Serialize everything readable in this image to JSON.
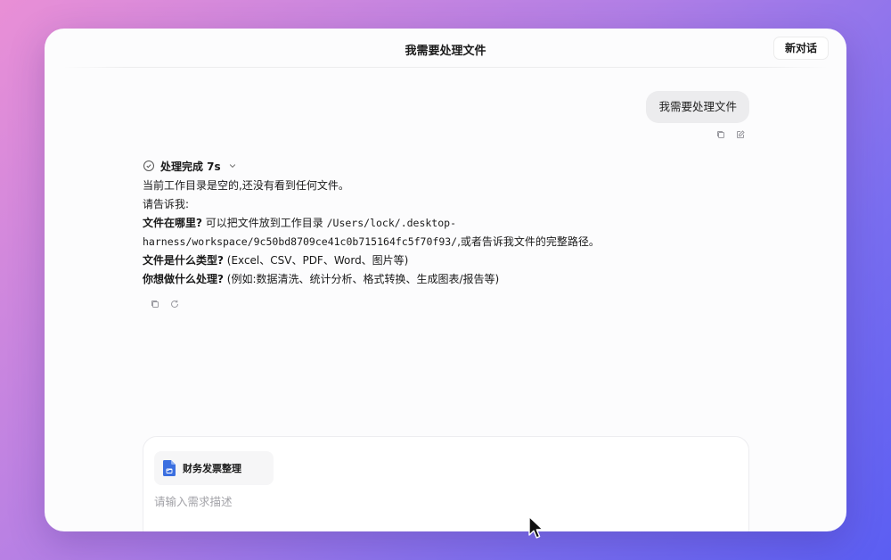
{
  "header": {
    "title": "我需要处理文件",
    "new_chat_label": "新对话"
  },
  "user_message": {
    "text": "我需要处理文件",
    "actions": [
      "copy-icon",
      "edit-icon"
    ]
  },
  "assistant_message": {
    "status": "处理完成 7s",
    "lines": {
      "l1": "当前工作目录是空的,还没有看到任何文件。",
      "l2": "请告诉我:",
      "l3_bold": "文件在哪里?",
      "l3_text": " 可以把文件放到工作目录 ",
      "l3_path": "/Users/lock/.desktop-",
      "l4_path": "harness/workspace/9c50bd8709ce41c0b715164fc5f70f93/",
      "l4_text": ",或者告诉我文件的完整路径。",
      "l5_bold": "文件是什么类型?",
      "l5_text": " (Excel、CSV、PDF、Word、图片等)",
      "l6_bold": "你想做什么处理?",
      "l6_text": " (例如:数据清洗、统计分析、格式转换、生成图表/报告等)"
    },
    "actions": [
      "copy-icon",
      "refresh-icon"
    ]
  },
  "composer": {
    "attachment_name": "财务发票整理",
    "placeholder": "请输入需求描述"
  },
  "colors": {
    "accent_file": "#3b6fe0",
    "user_bubble": "#ececee"
  }
}
